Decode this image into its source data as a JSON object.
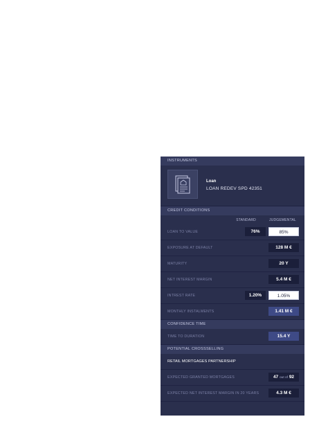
{
  "instruments": {
    "header": "INSTRUMENTS",
    "type": "Loan",
    "name": "LOAN REDEV SPD 42351",
    "icon": "document-icon"
  },
  "credit": {
    "header": "CREDIT CONDITIONS",
    "col_standard": "STANDARD",
    "col_judgemental": "JUDGEMENTAL",
    "rows": [
      {
        "label": "LOAN TO VALUE",
        "standard": "76%",
        "judgemental": "85%"
      },
      {
        "label": "EXPOSURE AT DEFAULT",
        "judgemental": "128 M €"
      },
      {
        "label": "MATURITY",
        "judgemental": "20 Y"
      },
      {
        "label": "NET INTEREST MARGIN",
        "judgemental": "5.4 M €"
      },
      {
        "label": "INTREST RATE",
        "standard": "1.20%",
        "judgemental": "1.05%"
      },
      {
        "label": "MONTHLY INSTALMENTS",
        "judgemental": "1.41 M €"
      }
    ]
  },
  "confidence": {
    "header": "CONFIDENCE TIME",
    "label": "TIME TO DURATION",
    "value": "15.4 Y"
  },
  "crossselling": {
    "header": "POTENTIAL CROSSSELLING",
    "product": "RETAIL MORTGAGES PARTNERSHIP",
    "mortgages_label": "EXPECTED GRANTED MORTGAGES",
    "mortgages_value": "47",
    "mortgages_sep": "out of",
    "mortgages_total": "92",
    "margin_label": "EXPECTED NET INTEREST MARGIN IN 20 YEARS",
    "margin_value": "4.3 M €"
  },
  "colors": {
    "panel": "#2a2f4d",
    "section_header": "#353b5e",
    "value_dark": "#1b1f3a",
    "value_highlight": "#3e4a86"
  }
}
